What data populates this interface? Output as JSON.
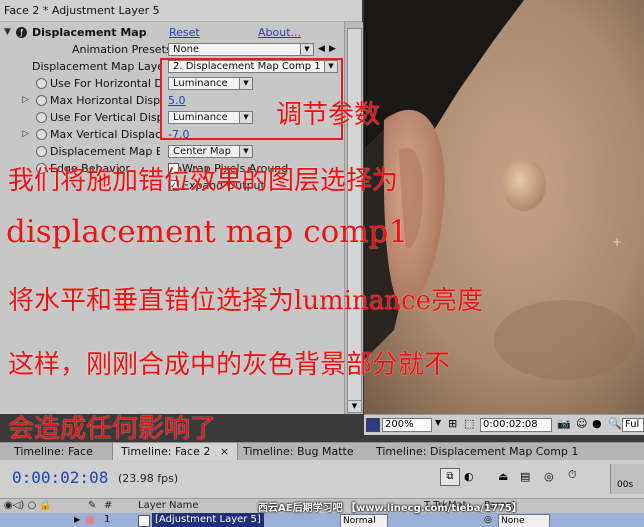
{
  "window": {
    "title": "Face 2 * Adjustment Layer 5"
  },
  "effect": {
    "name": "Displacement Map",
    "reset": "Reset",
    "about": "About...",
    "animation_presets_label": "Animation Presets:",
    "animation_presets_value": "None",
    "properties": [
      {
        "label": "Displacement Map Layer",
        "value": "2. Displacement Map Comp 1",
        "kind": "dropdown"
      },
      {
        "label": "Use For Horizontal Dis",
        "value": "Luminance",
        "kind": "dropdown"
      },
      {
        "label": "Max Horizontal Displac",
        "value": "5.0",
        "kind": "number"
      },
      {
        "label": "Use For Vertical Displa",
        "value": "Luminance",
        "kind": "dropdown"
      },
      {
        "label": "Max Vertical Displacem",
        "value": "-7.0",
        "kind": "number"
      },
      {
        "label": "Displacement Map Beh",
        "value": "Center Map",
        "kind": "dropdown"
      },
      {
        "label": "Edge Behavior",
        "value": "Wrap Pixels Around",
        "kind": "checkbox"
      }
    ],
    "expand_output": "Expand Output"
  },
  "viewer": {
    "zoom": "200%",
    "timecode": "0:00:02:08",
    "right_label": "Ful"
  },
  "timeline": {
    "tabs": [
      "Timeline: Face",
      "Timeline: Face 2",
      "Timeline: Bug Matte",
      "Timeline: Displacement Map Comp 1"
    ],
    "close_glyph": "×",
    "timecode": "0:00:02:08",
    "fps": "(23.98 fps)",
    "ruler_label": "00s",
    "columns": {
      "layer_name": "Layer Name",
      "mode": "Mode",
      "trkmat": "T TrkMat",
      "parent": "Parent",
      "number": "#"
    },
    "layer": {
      "number": "1",
      "name": "[Adjustment Layer 5]",
      "mode": "Normal",
      "parent": "None"
    }
  },
  "watermark": "西云AE后期学习吧 【www.linecg.com/tieba/1775】",
  "annotations": {
    "box_note": "调节参数",
    "line1": "我们将施加错位效果的图层选择为",
    "line2": "displacement map comp1",
    "line3": "将水平和垂直错位选择为luminance亮度",
    "line4": "这样，刚刚合成中的灰色背景部分就不",
    "line5": "会造成任何影响了"
  },
  "colors": {
    "annotation": "#ee1111",
    "link_blue": "#1c45b8",
    "panel": "#c7c7c7"
  }
}
